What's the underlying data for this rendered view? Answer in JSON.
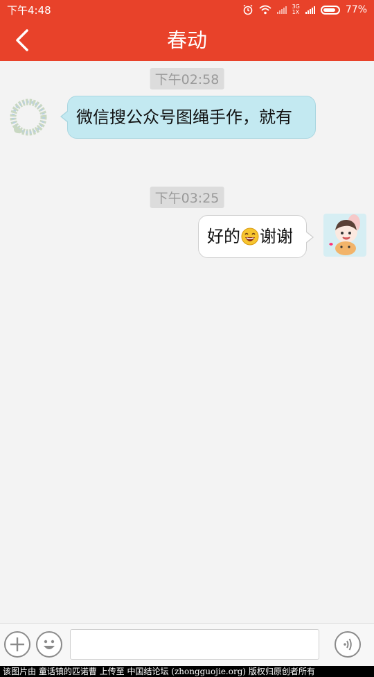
{
  "status_bar": {
    "time": "下午4:48",
    "network_label": "3G",
    "network_sub": "1X",
    "battery": "77%"
  },
  "header": {
    "title": "春动"
  },
  "messages": [
    {
      "timestamp": "下午02:58",
      "side": "left",
      "text": "微信搜公众号图绳手作，就有"
    },
    {
      "timestamp": "下午03:25",
      "side": "right",
      "text_before": "好的",
      "emoji": "laughing-emoji",
      "text_after": "谢谢"
    }
  ],
  "input": {
    "placeholder": ""
  },
  "watermark": "该图片由 童话镇的匹诺曹 上传至 中国结论坛 (zhongguojie.org) 版权归原创者所有",
  "colors": {
    "header": "#e8422a",
    "bubble_left": "#c3e9f1",
    "bubble_right": "#ffffff"
  }
}
